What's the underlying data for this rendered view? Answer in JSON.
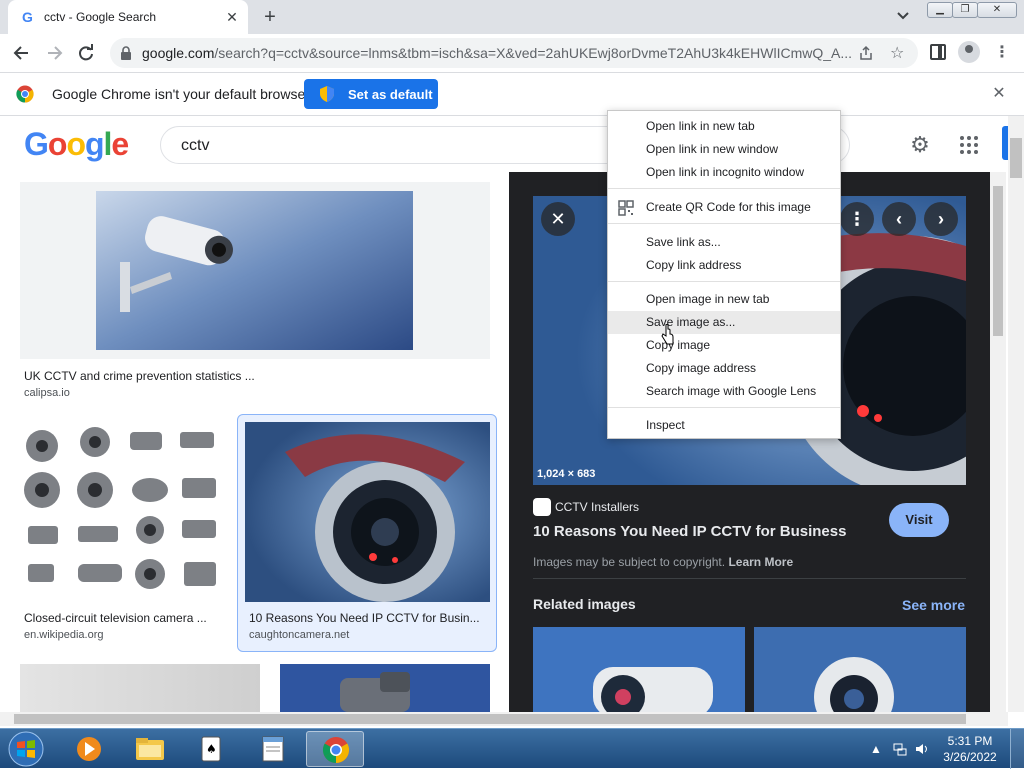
{
  "browser": {
    "tab_title": "cctv - Google Search",
    "tab_favicon": "G",
    "new_tab": "+",
    "url_host": "google.com",
    "url_path": "/search?q=cctv&source=lnms&tbm=isch&sa=X&ved=2ahUKEwj8orDvmeT2AhU3k4kEHWlICmwQ_A...",
    "infobar_message": "Google Chrome isn't your default browser",
    "set_default_label": "Set as default"
  },
  "page": {
    "logo": "Google",
    "query": "cctv"
  },
  "results": [
    {
      "caption": "UK CCTV and crime prevention statistics ...",
      "source": "calipsa.io"
    },
    {
      "caption": "Closed-circuit television camera ...",
      "source": "en.wikipedia.org"
    },
    {
      "caption": "10 Reasons You Need IP CCTV for Busin...",
      "source": "caughtoncamera.net"
    }
  ],
  "preview": {
    "dimensions": "1,024 × 683",
    "source_name": "CCTV Installers",
    "title": "10 Reasons You Need IP CCTV for Business",
    "visit_label": "Visit",
    "copyright_text": "Images may be subject to copyright.",
    "learn_more": "Learn More",
    "related_heading": "Related images",
    "see_more": "See more"
  },
  "context_menu": {
    "items": [
      "Open link in new tab",
      "Open link in new window",
      "Open link in incognito window",
      "Create QR Code for this image",
      "Save link as...",
      "Copy link address",
      "Open image in new tab",
      "Save image as...",
      "Copy image",
      "Copy image address",
      "Search image with Google Lens",
      "Inspect"
    ],
    "highlighted": "Save image as..."
  },
  "taskbar": {
    "time": "5:31 PM",
    "date": "3/26/2022"
  },
  "colors": {
    "accent": "#1a73e8",
    "preview_bg": "#202124",
    "link_blue": "#8ab4f8"
  }
}
